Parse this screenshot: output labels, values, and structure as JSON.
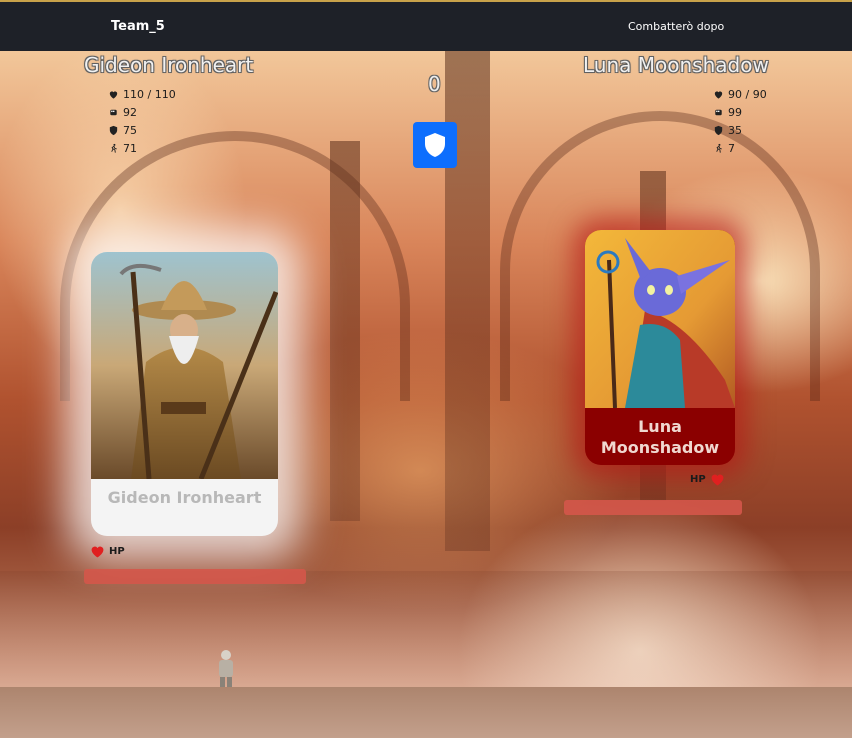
{
  "header": {
    "team_name": "Team_5",
    "later_label": "Combatterò dopo"
  },
  "battle": {
    "turn": "0",
    "defend_icon": "shield-icon"
  },
  "player": {
    "name": "Gideon Ironheart",
    "card_name": "Gideon Ironheart",
    "hp": "110 / 110",
    "attack": "92",
    "defense": "75",
    "speed": "71",
    "hp_label": "HP",
    "hp_fraction": 1.0
  },
  "enemy": {
    "name": "Luna Moonshadow",
    "card_name": "Luna Moonshadow",
    "hp": "90 / 90",
    "attack": "99",
    "defense": "35",
    "speed": "7",
    "hp_label": "HP",
    "hp_fraction": 1.0
  },
  "colors": {
    "accent": "#0d6efd",
    "hp_bar": "#d4564a",
    "enemy_card": "#8b0000",
    "topbar": "#1e2128"
  }
}
